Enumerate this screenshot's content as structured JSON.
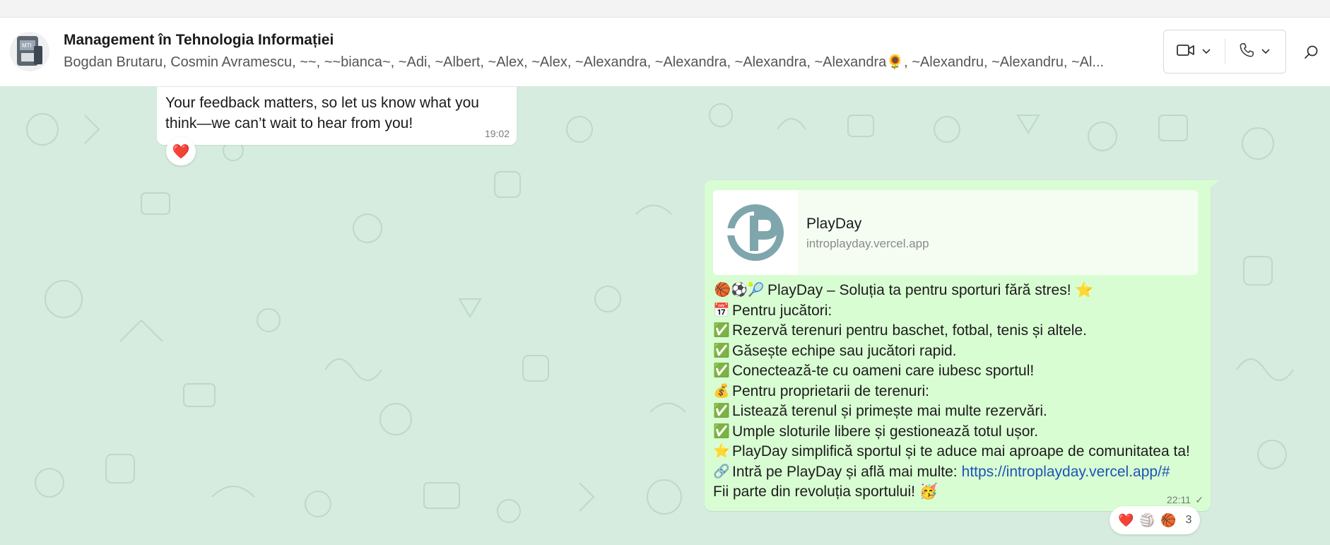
{
  "header": {
    "title": "Management în Tehnologia Informației",
    "members": "Bogdan Brutaru, Cosmin Avramescu, ~~, ~~bianca~, ~Adi, ~Albert, ~Alex, ~Alex, ~Alexandra, ~Alexandra, ~Alexandra, ~Alexandra🌻, ~Alexandru, ~Alexandru, ~Al...",
    "avatar_icon": "group-avatar",
    "video_icon": "video-camera-icon",
    "phone_icon": "phone-icon",
    "search_icon": "search-icon"
  },
  "messages": {
    "incoming": {
      "text": "Your feedback matters, so let us know what you think—we can’t wait to hear from you!",
      "time": "19:02",
      "reaction": "❤️"
    },
    "outgoing": {
      "preview": {
        "title": "PlayDay",
        "url": "introplayday.vercel.app"
      },
      "lines": [
        {
          "emoji": "🏀⚽🎾",
          "text": "PlayDay – Soluția ta pentru sporturi fără stres! ⭐"
        },
        {
          "emoji": "📅",
          "text": "Pentru jucători:"
        },
        {
          "emoji": "✅",
          "text": "Rezervă terenuri pentru baschet, fotbal, tenis și altele."
        },
        {
          "emoji": "✅",
          "text": "Găsește echipe sau jucători rapid."
        },
        {
          "emoji": "✅",
          "text": "Conectează-te cu oameni care iubesc sportul!"
        },
        {
          "emoji": "💰",
          "text": "Pentru proprietarii de terenuri:"
        },
        {
          "emoji": "✅",
          "text": "Listează terenul și primește mai multe rezervări."
        },
        {
          "emoji": "✅",
          "text": "Umple sloturile libere și gestionează totul ușor."
        },
        {
          "emoji": "⭐",
          "text": "PlayDay simplifică sportul și te aduce mai aproape de comunitatea ta!"
        },
        {
          "emoji": "🔗",
          "text": "Intră pe PlayDay și află mai multe:",
          "link": "https://introplayday.vercel.app/#"
        },
        {
          "emoji": "",
          "text": "Fii parte din revoluția sportului! 🥳"
        }
      ],
      "time": "22:11",
      "status": "✓",
      "reactions": {
        "emojis": [
          "❤️",
          "🏐",
          "🏀"
        ],
        "count": "3"
      }
    }
  },
  "colors": {
    "chat_bg": "#d5ecdf",
    "outgoing_bubble": "#d9fdd3",
    "link": "#1a55b5"
  }
}
